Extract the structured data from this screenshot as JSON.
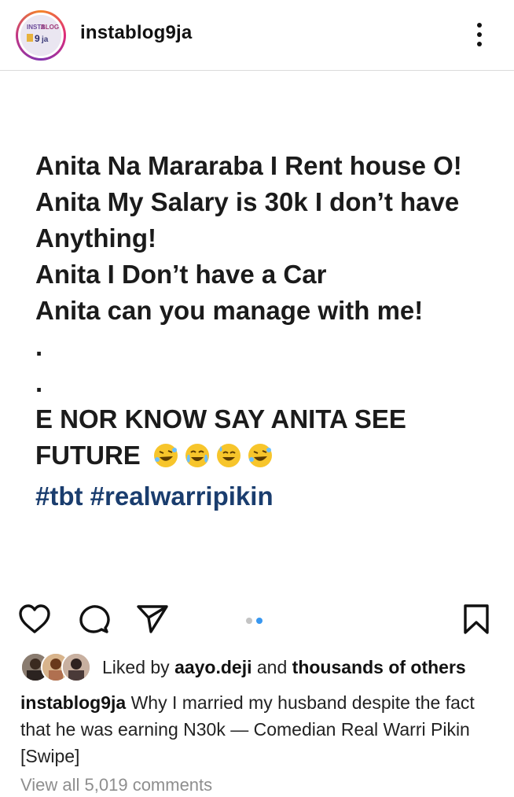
{
  "header": {
    "username": "instablog9ja",
    "avatar_text": "INSTABLOG 9ja"
  },
  "post": {
    "lines": [
      "Anita Na Mararaba I Rent house O!",
      "Anita My Salary is 30k I don’t have",
      "Anything!",
      "Anita I Don’t have a Car",
      "Anita can you manage with me!",
      ".",
      ".",
      "E NOR KNOW SAY ANITA SEE",
      "FUTURE"
    ],
    "hashtags": "#tbt #realwarripikin",
    "emojis": [
      "rolling-laughing",
      "tears-of-joy",
      "sweat-smile",
      "rolling-laughing"
    ]
  },
  "carousel": {
    "total": 2,
    "current": 2
  },
  "likes": {
    "prefix": "Liked by ",
    "user": "aayo.deji",
    "middle": " and ",
    "others": "thousands of others"
  },
  "caption": {
    "username": "instablog9ja",
    "text": " Why I married my husband despite the fact that he was earning N30k — Comedian Real Warri Pikin [Swipe]"
  },
  "comments": {
    "label": "View all 5,019 comments"
  },
  "colors": {
    "hashtag": "#1a3d6e",
    "carousel_active": "#3897f0",
    "carousel_inactive": "#c4c4c4"
  }
}
